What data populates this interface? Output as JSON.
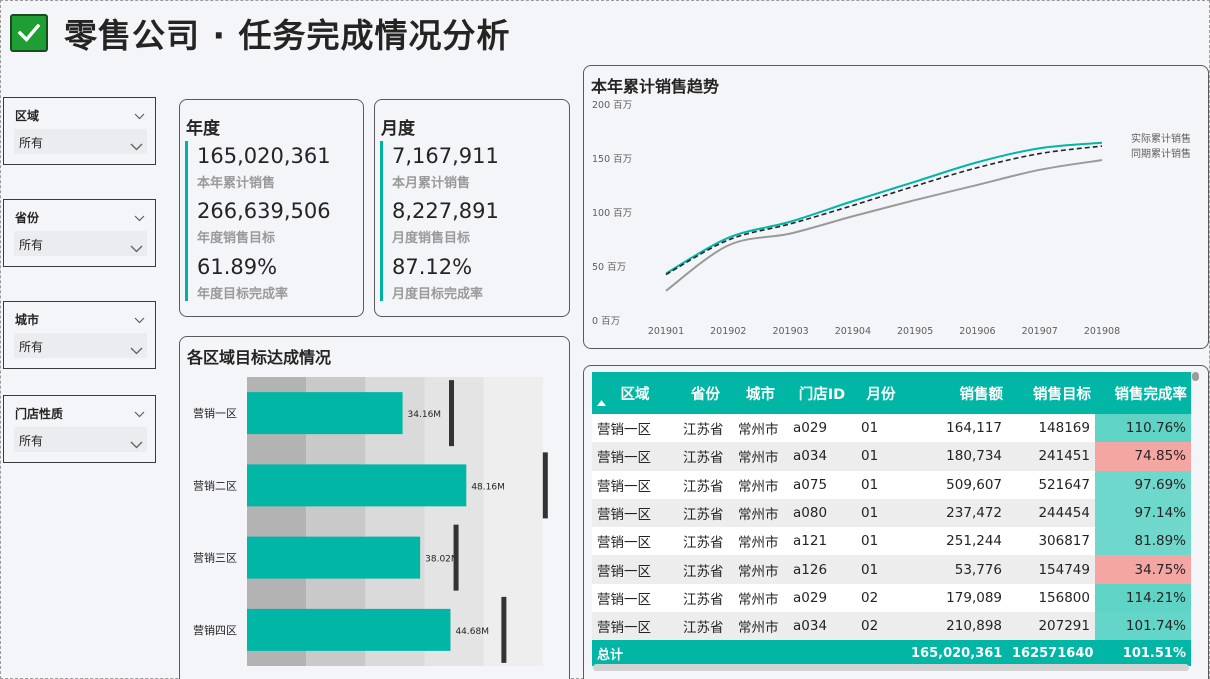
{
  "header": {
    "title": "零售公司 · 任务完成情况分析"
  },
  "slicers": [
    {
      "label": "区域",
      "value": "所有"
    },
    {
      "label": "省份",
      "value": "所有"
    },
    {
      "label": "城市",
      "value": "所有"
    },
    {
      "label": "门店性质",
      "value": "所有"
    }
  ],
  "annual": {
    "title": "年度",
    "items": [
      {
        "value": "165,020,361",
        "label": "本年累计销售"
      },
      {
        "value": "266,639,506",
        "label": "年度销售目标"
      },
      {
        "value": "61.89%",
        "label": "年度目标完成率"
      }
    ]
  },
  "monthly": {
    "title": "月度",
    "items": [
      {
        "value": "7,167,911",
        "label": "本月累计销售"
      },
      {
        "value": "8,227,891",
        "label": "月度销售目标"
      },
      {
        "value": "87.12%",
        "label": "月度目标完成率"
      }
    ]
  },
  "trend_chart": {
    "title": "本年累计销售趋势",
    "chart_data": {
      "type": "line",
      "x": [
        "201901",
        "201902",
        "201903",
        "201904",
        "201905",
        "201906",
        "201907",
        "201908"
      ],
      "ytick_labels": [
        "200 百万",
        "150 百万",
        "100 百万",
        "50 百万",
        "0 百万"
      ],
      "ylim": [
        0,
        200
      ],
      "series": [
        {
          "name": "实际累计销售",
          "color": "#01b6a5",
          "dash": false,
          "values": [
            44,
            77,
            92,
            111,
            129,
            147,
            160,
            165
          ]
        },
        {
          "name": "",
          "color": "#252423",
          "dash": true,
          "values": [
            43,
            75,
            90,
            107,
            125,
            142,
            155,
            162
          ]
        },
        {
          "name": "同期累计销售",
          "color": "#9a9a9a",
          "dash": false,
          "values": [
            28,
            70,
            81,
            97,
            112,
            126,
            140,
            149
          ]
        }
      ]
    }
  },
  "region_chart": {
    "title": "各区域目标达成情况",
    "chart_data": {
      "type": "bar",
      "categories": [
        "营销一区",
        "营销二区",
        "营销三区",
        "营销四区"
      ],
      "values": [
        34.16,
        48.16,
        38.02,
        44.68
      ],
      "value_labels": [
        "34.16M",
        "48.16M",
        "38.02M",
        "44.68M"
      ],
      "targets": [
        44.8,
        65.4,
        45.8,
        56.3
      ],
      "xlim": [
        0,
        65
      ]
    }
  },
  "table": {
    "sort_icon": "sort-ascending-icon",
    "columns": [
      "区域",
      "省份",
      "城市",
      "门店ID",
      "月份",
      "销售额",
      "销售目标",
      "销售完成率"
    ],
    "rows": [
      [
        "营销一区",
        "江苏省",
        "常州市",
        "a029",
        "01",
        "164,117",
        "148169",
        "110.76%"
      ],
      [
        "营销一区",
        "江苏省",
        "常州市",
        "a034",
        "01",
        "180,734",
        "241451",
        "74.85%"
      ],
      [
        "营销一区",
        "江苏省",
        "常州市",
        "a075",
        "01",
        "509,607",
        "521647",
        "97.69%"
      ],
      [
        "营销一区",
        "江苏省",
        "常州市",
        "a080",
        "01",
        "237,472",
        "244454",
        "97.14%"
      ],
      [
        "营销一区",
        "江苏省",
        "常州市",
        "a121",
        "01",
        "251,244",
        "306817",
        "81.89%"
      ],
      [
        "营销一区",
        "江苏省",
        "常州市",
        "a126",
        "01",
        "53,776",
        "154749",
        "34.75%"
      ],
      [
        "营销一区",
        "江苏省",
        "常州市",
        "a029",
        "02",
        "179,089",
        "156800",
        "114.21%"
      ],
      [
        "营销一区",
        "江苏省",
        "常州市",
        "a034",
        "02",
        "210,898",
        "207291",
        "101.74%"
      ]
    ],
    "rate_colors": [
      "#5fd3c6",
      "#f4a6a3",
      "#6fd8cc",
      "#6fd8cc",
      "#70d7cc",
      "#f4a6a3",
      "#5fd3c6",
      "#64d5c9"
    ],
    "total": [
      "总计",
      "",
      "",
      "",
      "",
      "165,020,361",
      "162571640",
      "101.51%"
    ]
  },
  "colors": {
    "accent": "#01b6a5",
    "negative": "#f4a6a3",
    "positive": "#6fd8cc",
    "check": "#1f9e33"
  }
}
